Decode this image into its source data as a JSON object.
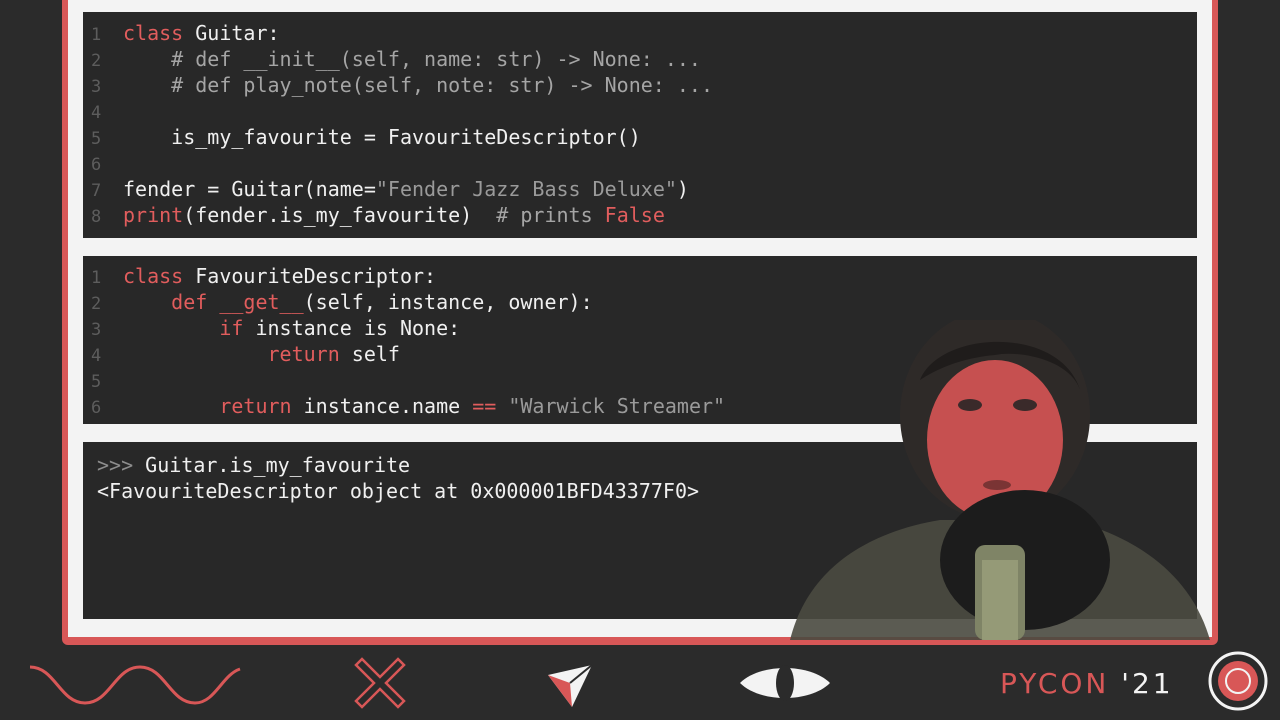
{
  "colors": {
    "accent": "#d85757",
    "panel": "#282828",
    "slide": "#f3f3f3",
    "background": "#2b2b2b"
  },
  "code_block_1": [
    {
      "n": "1",
      "parts": [
        {
          "t": "class",
          "c": "kw"
        },
        {
          "t": " Guitar:",
          "c": "txt"
        }
      ]
    },
    {
      "n": "2",
      "parts": [
        {
          "t": "    # def __init__(self, name: str) -> None: ...",
          "c": "cm"
        }
      ]
    },
    {
      "n": "3",
      "parts": [
        {
          "t": "    # def play_note(self, note: str) -> None: ...",
          "c": "cm"
        }
      ]
    },
    {
      "n": "4",
      "parts": []
    },
    {
      "n": "5",
      "parts": [
        {
          "t": "    is_my_favourite = FavouriteDescriptor()",
          "c": "txt"
        }
      ]
    },
    {
      "n": "6",
      "parts": []
    },
    {
      "n": "7",
      "parts": [
        {
          "t": "fender = Guitar(name=",
          "c": "txt"
        },
        {
          "t": "\"Fender Jazz Bass Deluxe\"",
          "c": "st"
        },
        {
          "t": ")",
          "c": "txt"
        }
      ]
    },
    {
      "n": "8",
      "parts": [
        {
          "t": "print",
          "c": "kw"
        },
        {
          "t": "(fender.is_my_favourite)  ",
          "c": "txt"
        },
        {
          "t": "# prints ",
          "c": "cm"
        },
        {
          "t": "False",
          "c": "kw"
        }
      ]
    }
  ],
  "code_block_2": [
    {
      "n": "1",
      "parts": [
        {
          "t": "class",
          "c": "kw"
        },
        {
          "t": " FavouriteDescriptor:",
          "c": "txt"
        }
      ]
    },
    {
      "n": "2",
      "parts": [
        {
          "t": "    ",
          "c": "txt"
        },
        {
          "t": "def",
          "c": "kw"
        },
        {
          "t": " ",
          "c": "txt"
        },
        {
          "t": "__get__",
          "c": "kw"
        },
        {
          "t": "(self, instance, owner):",
          "c": "txt"
        }
      ]
    },
    {
      "n": "3",
      "parts": [
        {
          "t": "        ",
          "c": "txt"
        },
        {
          "t": "if",
          "c": "kw"
        },
        {
          "t": " instance is None:",
          "c": "txt"
        }
      ]
    },
    {
      "n": "4",
      "parts": [
        {
          "t": "            ",
          "c": "txt"
        },
        {
          "t": "return",
          "c": "kw"
        },
        {
          "t": " self",
          "c": "txt"
        }
      ]
    },
    {
      "n": "5",
      "parts": []
    },
    {
      "n": "6",
      "parts": [
        {
          "t": "        ",
          "c": "txt"
        },
        {
          "t": "return",
          "c": "kw"
        },
        {
          "t": " instance.name ",
          "c": "txt"
        },
        {
          "t": "==",
          "c": "kw"
        },
        {
          "t": " ",
          "c": "txt"
        },
        {
          "t": "\"Warwick Streamer\"",
          "c": "st"
        }
      ]
    }
  ],
  "repl": {
    "prompt": ">>> ",
    "input": "Guitar.is_my_favourite",
    "output": "<FavouriteDescriptor object at 0x000001BFD43377F0>"
  },
  "logo": {
    "name": "PYCON",
    "year": " '21"
  },
  "icons": [
    "wave-icon",
    "cross-icon",
    "paper-plane-icon",
    "eye-icon",
    "target-logo-icon"
  ]
}
